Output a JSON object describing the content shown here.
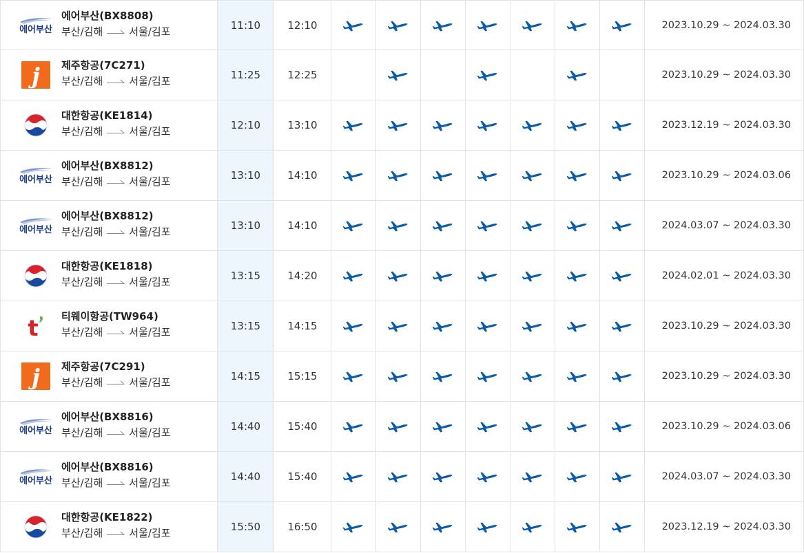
{
  "colors": {
    "plane": "#0a5ba8",
    "dep_column_bg": "#edf5fd",
    "border": "#e3e3e3",
    "brand_jeju": "#f26b1c",
    "brand_korean_red": "#d8232a",
    "brand_korean_blue": "#1a4aa0",
    "brand_tway": "#d4232a",
    "brand_airbusan": "#1d3d8c"
  },
  "icons": {
    "plane": "airplane-icon",
    "route_arrow": "long-arrow-right-icon"
  },
  "logos": {
    "airbusan_text": "에어부산",
    "jeju_text": "j",
    "tway_text": "t"
  },
  "flights": [
    {
      "airline_logo": "airbusan",
      "name": "에어부산(BX8808)",
      "from": "부산/김해",
      "to": "서울/김포",
      "dep": "11:10",
      "arr": "12:10",
      "days": [
        true,
        true,
        true,
        true,
        true,
        true,
        true
      ],
      "period": "2023.10.29 ~ 2024.03.30"
    },
    {
      "airline_logo": "jeju",
      "name": "제주항공(7C271)",
      "from": "부산/김해",
      "to": "서울/김포",
      "dep": "11:25",
      "arr": "12:25",
      "days": [
        false,
        true,
        false,
        true,
        false,
        true,
        false
      ],
      "period": "2023.10.29 ~ 2024.03.30"
    },
    {
      "airline_logo": "korean",
      "name": "대한항공(KE1814)",
      "from": "부산/김해",
      "to": "서울/김포",
      "dep": "12:10",
      "arr": "13:10",
      "days": [
        true,
        true,
        true,
        true,
        true,
        true,
        true
      ],
      "period": "2023.12.19 ~ 2024.03.30"
    },
    {
      "airline_logo": "airbusan",
      "name": "에어부산(BX8812)",
      "from": "부산/김해",
      "to": "서울/김포",
      "dep": "13:10",
      "arr": "14:10",
      "days": [
        true,
        true,
        true,
        true,
        true,
        true,
        true
      ],
      "period": "2023.10.29 ~ 2024.03.06"
    },
    {
      "airline_logo": "airbusan",
      "name": "에어부산(BX8812)",
      "from": "부산/김해",
      "to": "서울/김포",
      "dep": "13:10",
      "arr": "14:10",
      "days": [
        true,
        true,
        true,
        true,
        true,
        true,
        true
      ],
      "period": "2024.03.07 ~ 2024.03.30"
    },
    {
      "airline_logo": "korean",
      "name": "대한항공(KE1818)",
      "from": "부산/김해",
      "to": "서울/김포",
      "dep": "13:15",
      "arr": "14:20",
      "days": [
        true,
        true,
        true,
        true,
        true,
        true,
        true
      ],
      "period": "2024.02.01 ~ 2024.03.30"
    },
    {
      "airline_logo": "tway",
      "name": "티웨이항공(TW964)",
      "from": "부산/김해",
      "to": "서울/김포",
      "dep": "13:15",
      "arr": "14:15",
      "days": [
        true,
        true,
        true,
        true,
        true,
        true,
        true
      ],
      "period": "2023.10.29 ~ 2024.03.30"
    },
    {
      "airline_logo": "jeju",
      "name": "제주항공(7C291)",
      "from": "부산/김해",
      "to": "서울/김포",
      "dep": "14:15",
      "arr": "15:15",
      "days": [
        true,
        true,
        true,
        true,
        true,
        true,
        true
      ],
      "period": "2023.10.29 ~ 2024.03.30"
    },
    {
      "airline_logo": "airbusan",
      "name": "에어부산(BX8816)",
      "from": "부산/김해",
      "to": "서울/김포",
      "dep": "14:40",
      "arr": "15:40",
      "days": [
        true,
        true,
        true,
        true,
        true,
        true,
        true
      ],
      "period": "2023.10.29 ~ 2024.03.06"
    },
    {
      "airline_logo": "airbusan",
      "name": "에어부산(BX8816)",
      "from": "부산/김해",
      "to": "서울/김포",
      "dep": "14:40",
      "arr": "15:40",
      "days": [
        true,
        true,
        true,
        true,
        true,
        true,
        true
      ],
      "period": "2024.03.07 ~ 2024.03.30"
    },
    {
      "airline_logo": "korean",
      "name": "대한항공(KE1822)",
      "from": "부산/김해",
      "to": "서울/김포",
      "dep": "15:50",
      "arr": "16:50",
      "days": [
        true,
        true,
        true,
        true,
        true,
        true,
        true
      ],
      "period": "2023.12.19 ~ 2024.03.30"
    }
  ]
}
